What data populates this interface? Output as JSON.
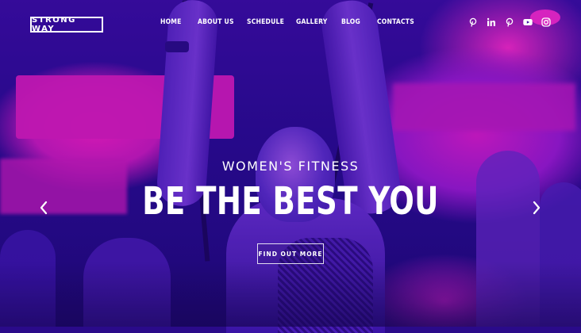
{
  "brand": {
    "logo_text": "STRONG WAY"
  },
  "nav": {
    "items": [
      {
        "label": "HOME"
      },
      {
        "label": "ABOUT US"
      },
      {
        "label": "SCHEDULE"
      },
      {
        "label": "GALLERY"
      },
      {
        "label": "BLOG"
      },
      {
        "label": "CONTACTS"
      }
    ]
  },
  "social": {
    "icons": [
      "pinterest-icon",
      "linkedin-icon",
      "pinterest-icon",
      "youtube-icon",
      "instagram-icon"
    ]
  },
  "hero": {
    "subtitle": "WOMEN'S FITNESS",
    "headline": "BE THE BEST YOU",
    "cta_label": "FIND OUT MORE"
  },
  "slider": {
    "prev_icon": "chevron-left-icon",
    "next_icon": "chevron-right-icon"
  },
  "colors": {
    "primary_purple": "#3b0da8",
    "accent_magenta": "#e21bc4",
    "text": "#ffffff"
  }
}
